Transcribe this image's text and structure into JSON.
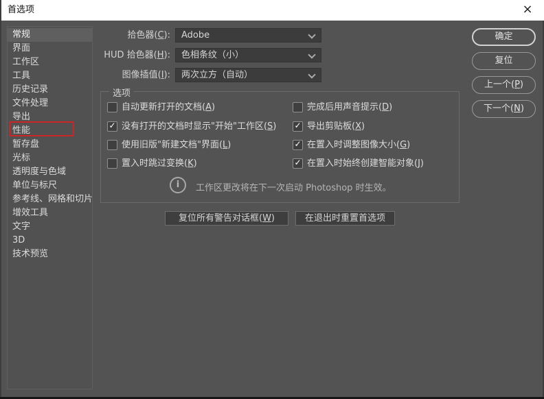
{
  "window": {
    "title": "首选项",
    "close_glyph": "×"
  },
  "sidebar": {
    "items": [
      {
        "label": "常规",
        "selected": true
      },
      {
        "label": "界面",
        "selected": false
      },
      {
        "label": "工作区",
        "selected": false
      },
      {
        "label": "工具",
        "selected": false
      },
      {
        "label": "历史记录",
        "selected": false
      },
      {
        "label": "文件处理",
        "selected": false
      },
      {
        "label": "导出",
        "selected": false
      },
      {
        "label": "性能",
        "selected": false,
        "annotated": true
      },
      {
        "label": "暂存盘",
        "selected": false
      },
      {
        "label": "光标",
        "selected": false
      },
      {
        "label": "透明度与色域",
        "selected": false
      },
      {
        "label": "单位与标尺",
        "selected": false
      },
      {
        "label": "参考线、网格和切片",
        "selected": false
      },
      {
        "label": "增效工具",
        "selected": false
      },
      {
        "label": "文字",
        "selected": false
      },
      {
        "label": "3D",
        "selected": false
      },
      {
        "label": "技术预览",
        "selected": false
      }
    ]
  },
  "dropdowns": [
    {
      "label": "拾色器(C):",
      "value": "Adobe"
    },
    {
      "label": "HUD 拾色器(H):",
      "value": "色相条纹（小）"
    },
    {
      "label": "图像插值(I):",
      "value": "两次立方（自动）"
    }
  ],
  "options_group": {
    "legend": "选项",
    "left": [
      {
        "label": "自动更新打开的文档(A)",
        "checked": false
      },
      {
        "label": "没有打开的文档时显示\"开始\"工作区(S)",
        "checked": true
      },
      {
        "label": "使用旧版\"新建文档\"界面(L)",
        "checked": false
      },
      {
        "label": "置入时跳过变换(K)",
        "checked": false
      }
    ],
    "right": [
      {
        "label": "完成后用声音提示(D)",
        "checked": false
      },
      {
        "label": "导出剪贴板(X)",
        "checked": true
      },
      {
        "label": "在置入时调整图像大小(G)",
        "checked": true
      },
      {
        "label": "在置入时始终创建智能对象(J)",
        "checked": true
      }
    ],
    "check_glyph": "✓",
    "info_glyph": "i",
    "info_text": "工作区更改将在下一次启动 Photoshop 时生效。"
  },
  "action_buttons": {
    "reset_warnings": "复位所有警告对话框(W)",
    "reset_on_quit": "在退出时重置首选项"
  },
  "side_buttons": [
    {
      "label": "确定",
      "primary": true
    },
    {
      "label": "复位",
      "primary": false
    },
    {
      "label": "上一个(P)",
      "primary": false
    },
    {
      "label": "下一个(N)",
      "primary": false
    }
  ],
  "annotation": {
    "color": "#cc2525"
  }
}
